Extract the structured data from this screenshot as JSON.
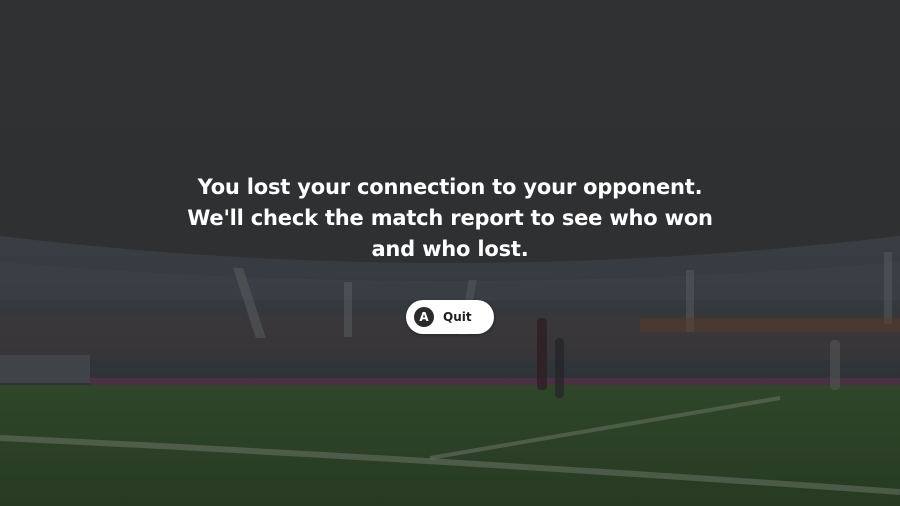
{
  "dialog": {
    "message_lines": [
      "You lost your connection to your opponent.",
      "We'll check the match report to see who won",
      "and who lost."
    ],
    "quit_button": {
      "button_glyph": "A",
      "label": "Quit"
    }
  },
  "background": {
    "description_icon": "stadium-icon",
    "pitch_color": "#3f5a34",
    "overlay_color": "#2f3133"
  }
}
